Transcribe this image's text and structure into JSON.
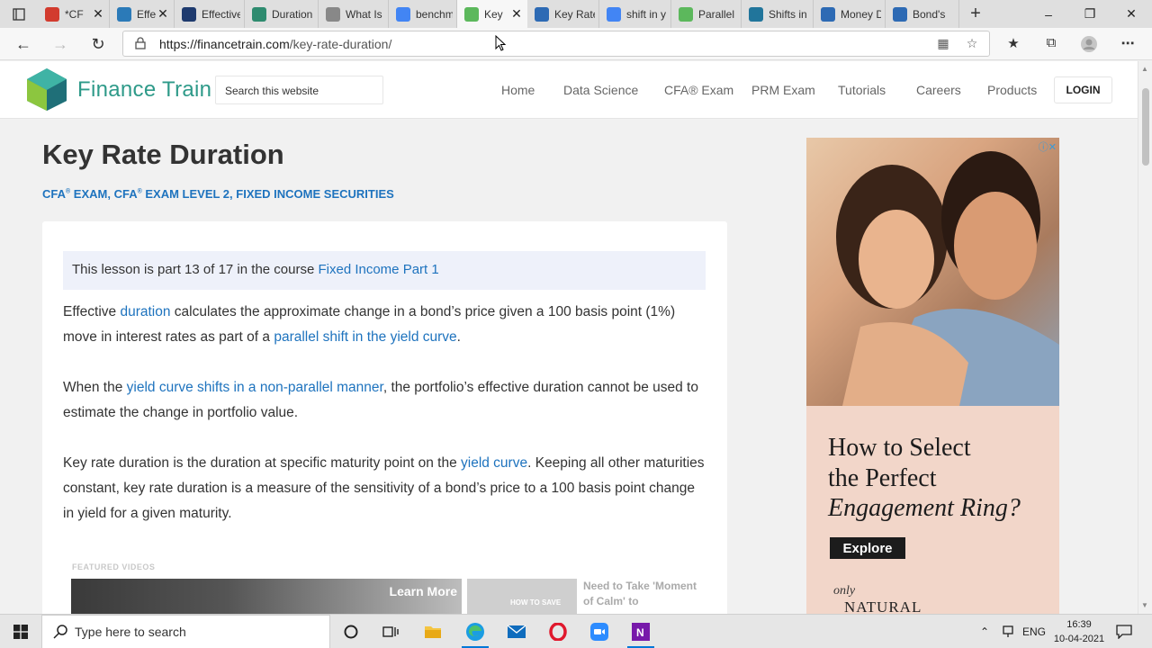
{
  "browser": {
    "tabs": [
      {
        "label": "*CF",
        "icon": "pdf-icon",
        "color": "#d23b2e"
      },
      {
        "label": "Effe",
        "icon": "financetrain-f-icon",
        "color": "#2b7ab8"
      },
      {
        "label": "Effective",
        "icon": "wall-street-mojo-icon",
        "color": "#1e3a6e"
      },
      {
        "label": "Duration",
        "icon": "investopedia-icon",
        "color": "#2e8b6f"
      },
      {
        "label": "What Is",
        "icon": "page-icon",
        "color": "#888888"
      },
      {
        "label": "benchma",
        "icon": "google-icon",
        "color": "#4285f4"
      },
      {
        "label": "Key",
        "icon": "financetrain-icon",
        "color": "#5cb85c"
      },
      {
        "label": "Key Rate",
        "icon": "financetrain-icon",
        "color": "#2d6ab4"
      },
      {
        "label": "shift in y",
        "icon": "google-icon",
        "color": "#4285f4"
      },
      {
        "label": "Parallel a",
        "icon": "financetrain-icon",
        "color": "#5cb85c"
      },
      {
        "label": "Shifts in",
        "icon": "wordpress-icon",
        "color": "#21759b"
      },
      {
        "label": "Money D",
        "icon": "financetrain-icon",
        "color": "#2d6ab4"
      },
      {
        "label": "Bond's",
        "icon": "financetrain-icon",
        "color": "#2d6ab4"
      }
    ],
    "url_host": "https://financetrain.com",
    "url_path": "/key-rate-duration/"
  },
  "site": {
    "brand": "Finance Train",
    "search_placeholder": "Search this website",
    "menu": [
      "Home",
      "Data Science",
      "CFA® Exam",
      "PRM Exam",
      "Tutorials",
      "Careers",
      "Products"
    ],
    "login": "LOGIN"
  },
  "article": {
    "title": "Key Rate Duration",
    "categories": {
      "c1a": "CFA",
      "c1b": " EXAM, ",
      "c2a": "CFA",
      "c2b": " EXAM LEVEL 2, ",
      "c3": "FIXED INCOME SECURITIES",
      "reg": "®"
    },
    "notice_prefix": "This lesson is part 13 of 17 in the course ",
    "notice_link": "Fixed Income Part 1",
    "p1_a": "Effective ",
    "p1_link1": "duration",
    "p1_b": " calculates the approximate change in a bond’s price given a 100 basis point (1%) move in interest rates as part of a ",
    "p1_link2": "parallel shift in the yield curve",
    "p1_c": ".",
    "p2_a": "When the ",
    "p2_link": "yield curve shifts in a non-parallel manner",
    "p2_b": ", the portfolio’s effective duration cannot be used to estimate the change in portfolio value.",
    "p3_a": "Key rate duration is the duration at specific maturity point on the ",
    "p3_link": "yield curve",
    "p3_b": ". Keeping all other maturities constant, key rate duration is a measure of the sensitivity of a bond’s price to a 100 basis point change in yield for a given maturity.",
    "featured_label": "FEATURED VIDEOS",
    "learn_more": "Learn More",
    "thumb_text": "HOW TO SAVE",
    "video_caption": "Need to Take 'Moment of Calm' to"
  },
  "ad": {
    "headline_1": "How to Select",
    "headline_2": "the Perfect",
    "headline_3": "Engagement Ring?",
    "button": "Explore",
    "brand_script": "only",
    "brand_word": "NATURAL"
  },
  "taskbar": {
    "search_placeholder": "Type here to search",
    "lang": "ENG",
    "time": "16:39",
    "date": "10-04-2021"
  }
}
